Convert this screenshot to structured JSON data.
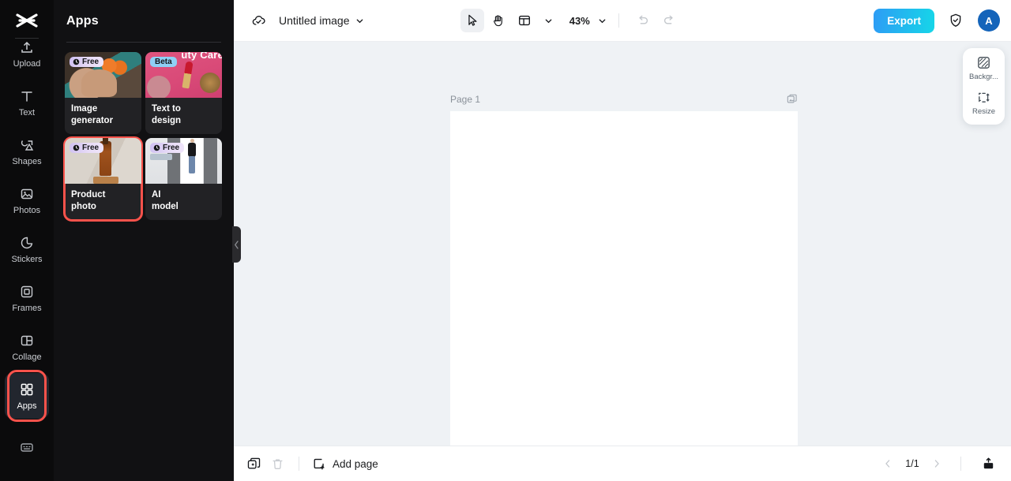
{
  "rail": {
    "logo_icon": "capcut-logo-icon",
    "items": [
      {
        "label": "Upload",
        "icon": "upload-icon",
        "active": false
      },
      {
        "label": "Text",
        "icon": "text-icon",
        "active": false
      },
      {
        "label": "Shapes",
        "icon": "shapes-icon",
        "active": false
      },
      {
        "label": "Photos",
        "icon": "photos-icon",
        "active": false
      },
      {
        "label": "Stickers",
        "icon": "stickers-icon",
        "active": false
      },
      {
        "label": "Frames",
        "icon": "frames-icon",
        "active": false
      },
      {
        "label": "Collage",
        "icon": "collage-icon",
        "active": false
      },
      {
        "label": "Apps",
        "icon": "apps-grid-icon",
        "active": true
      }
    ],
    "bottom_icon": "keyboard-icon",
    "selection_color": "#f9524b",
    "active_bg": "#22262e"
  },
  "panel": {
    "title": "Apps",
    "collapse_icon": "chevron-left-icon",
    "cards": [
      {
        "label": "Image\ngenerator",
        "label_line1": "Image",
        "label_line2": "generator",
        "badge": "Free",
        "badge_type": "free",
        "selected": false
      },
      {
        "label": "Text to design",
        "label_line1": "Text to",
        "label_line2": "design",
        "badge": "Beta",
        "badge_type": "beta",
        "thumb_text": "uty Care",
        "selected": false
      },
      {
        "label": "Product photo",
        "label_line1": "Product",
        "label_line2": "photo",
        "badge": "Free",
        "badge_type": "free",
        "selected": true
      },
      {
        "label": "AI model",
        "label_line1": "AI",
        "label_line2": "model",
        "badge": "Free",
        "badge_type": "free",
        "selected": false
      }
    ]
  },
  "topbar": {
    "cloud_icon": "cloud-saved-icon",
    "doc_title": "Untitled image",
    "title_chevron": "chevron-down-icon",
    "tools": [
      {
        "name": "select-tool",
        "icon": "cursor-arrow-icon",
        "active": true
      },
      {
        "name": "hand-tool",
        "icon": "hand-icon",
        "active": false
      },
      {
        "name": "layout-tool",
        "icon": "layout-panel-icon",
        "active": false
      }
    ],
    "zoom_level": "43%",
    "zoom_chevron": "chevron-down-icon",
    "undo_icon": "undo-icon",
    "redo_icon": "redo-icon",
    "export_label": "Export",
    "export_gradient_from": "#2d9cf5",
    "export_gradient_to": "#16d6e8",
    "shield_icon": "shield-check-icon",
    "avatar_initial": "A",
    "avatar_color": "#1464ba"
  },
  "canvas": {
    "page_label": "Page 1",
    "duplicate_icon": "duplicate-page-icon",
    "background_color": "#eff2f5",
    "page_color": "#ffffff"
  },
  "float_panel": {
    "items": [
      {
        "label": "Backgr...",
        "icon": "background-pattern-icon"
      },
      {
        "label": "Resize",
        "icon": "resize-icon"
      }
    ]
  },
  "bottombar": {
    "duplicate_icon": "duplicate-icon",
    "delete_icon": "trash-icon",
    "add_page_label": "Add page",
    "add_page_icon": "square-plus-icon",
    "page_indicator": "1/1",
    "prev_icon": "chevron-left-icon",
    "next_icon": "chevron-right-icon",
    "export_icon": "upload-box-icon"
  }
}
